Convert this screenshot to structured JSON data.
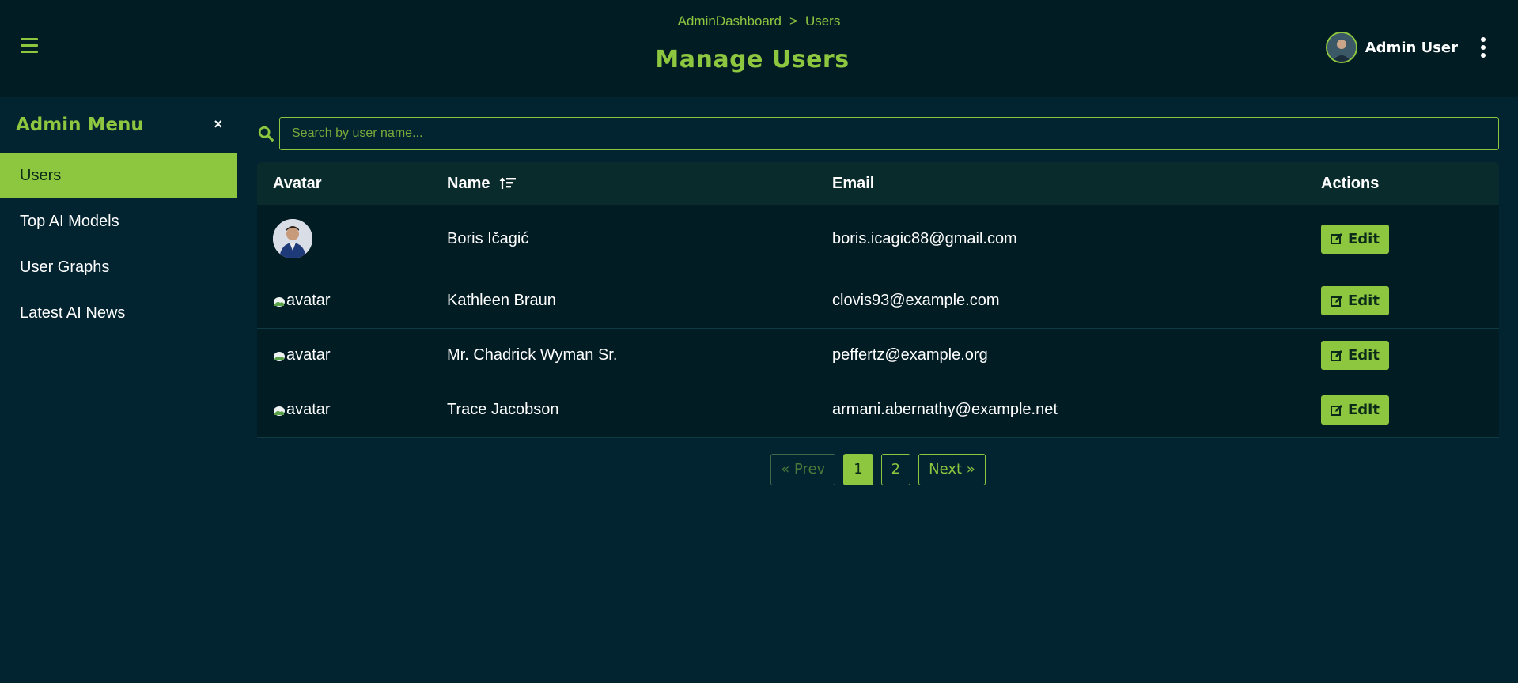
{
  "header": {
    "breadcrumb": {
      "root": "AdminDashboard",
      "separator": ">",
      "current": "Users"
    },
    "title": "Manage Users",
    "user_name": "Admin User",
    "icons": {
      "menu": "hamburger-menu-icon",
      "more": "kebab-vertical-icon"
    }
  },
  "sidebar": {
    "title": "Admin Menu",
    "close_label": "×",
    "items": [
      {
        "label": "Users",
        "active": true
      },
      {
        "label": "Top AI Models",
        "active": false
      },
      {
        "label": "User Graphs",
        "active": false
      },
      {
        "label": "Latest AI News",
        "active": false
      }
    ]
  },
  "search": {
    "placeholder": "Search by user name...",
    "value": ""
  },
  "table": {
    "columns": {
      "avatar": "Avatar",
      "name": "Name",
      "email": "Email",
      "actions": "Actions"
    },
    "rows": [
      {
        "avatar": "photo",
        "avatar_alt": "",
        "name": "Boris Ičagić",
        "email": "boris.icagic88@gmail.com",
        "action": "Edit"
      },
      {
        "avatar": "broken",
        "avatar_alt": "avatar",
        "name": "Kathleen Braun",
        "email": "clovis93@example.com",
        "action": "Edit"
      },
      {
        "avatar": "broken",
        "avatar_alt": "avatar",
        "name": "Mr. Chadrick Wyman Sr.",
        "email": "peffertz@example.org",
        "action": "Edit"
      },
      {
        "avatar": "broken",
        "avatar_alt": "avatar",
        "name": "Trace Jacobson",
        "email": "armani.abernathy@example.net",
        "action": "Edit"
      }
    ]
  },
  "pagination": {
    "prev": "« Prev",
    "pages": [
      "1",
      "2"
    ],
    "current_page": "1",
    "next": "Next »"
  },
  "colors": {
    "accent": "#8dc63f",
    "background": "#022330",
    "header_bg": "#021c24"
  }
}
